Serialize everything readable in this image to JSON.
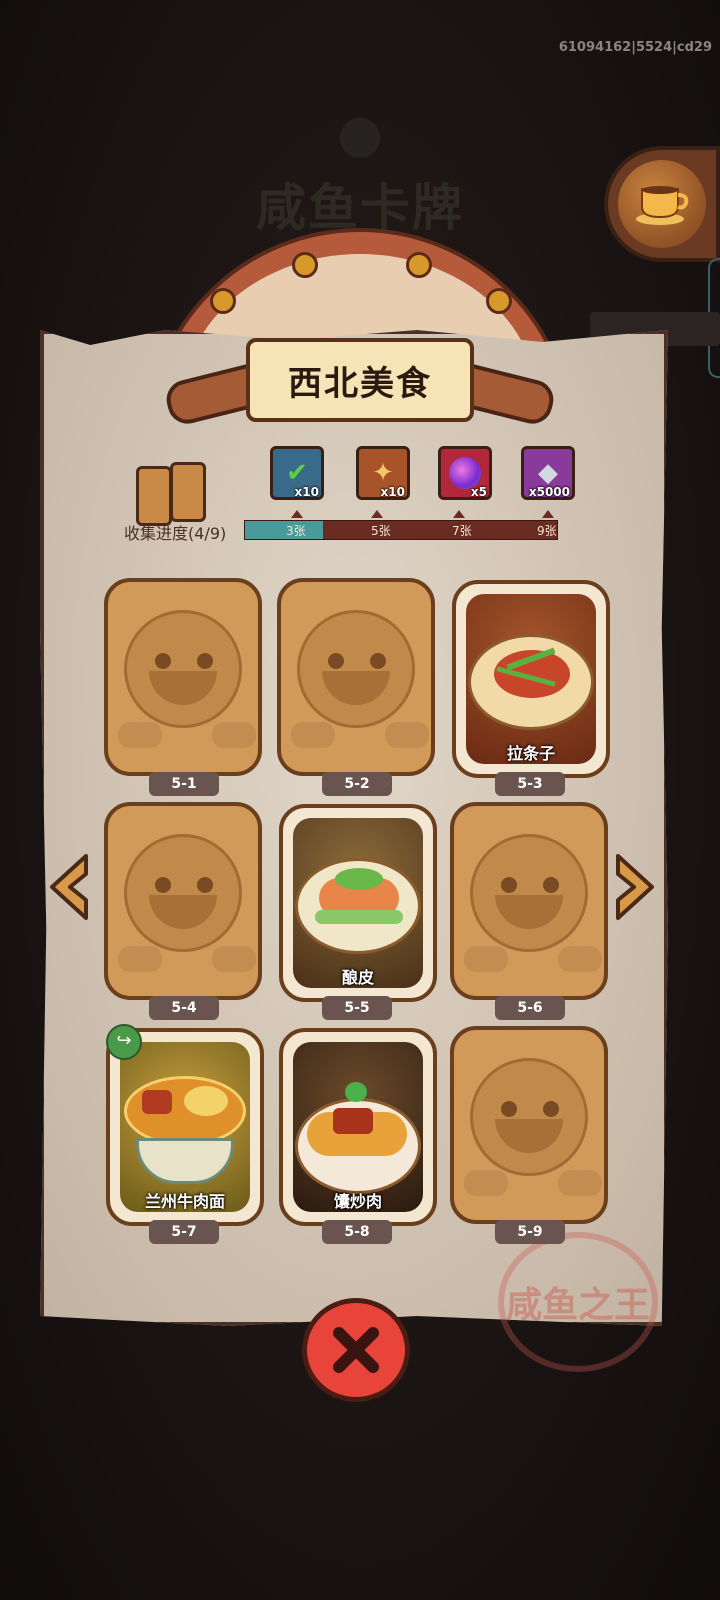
{
  "debug_id": "61094162|5524|cd29",
  "background_title": "咸鱼卡牌",
  "panel": {
    "title": "西北美食",
    "collect_label": "收集进度(4/9)",
    "progress": {
      "collected": 4,
      "total": 9
    }
  },
  "rewards": [
    {
      "icon": "chest-check-icon",
      "qty": "x10"
    },
    {
      "icon": "key-scroll-icon",
      "qty": "x10"
    },
    {
      "icon": "purple-orb-icon",
      "qty": "x5"
    },
    {
      "icon": "crystal-icon",
      "qty": "x5000"
    }
  ],
  "tiers": [
    "3张",
    "5张",
    "7张",
    "9张"
  ],
  "cards": [
    {
      "id": "5-1",
      "name": "",
      "unlocked": false
    },
    {
      "id": "5-2",
      "name": "",
      "unlocked": false
    },
    {
      "id": "5-3",
      "name": "拉条子",
      "unlocked": true
    },
    {
      "id": "5-4",
      "name": "",
      "unlocked": false
    },
    {
      "id": "5-5",
      "name": "酿皮",
      "unlocked": true
    },
    {
      "id": "5-6",
      "name": "",
      "unlocked": false
    },
    {
      "id": "5-7",
      "name": "兰州牛肉面",
      "unlocked": true
    },
    {
      "id": "5-8",
      "name": "馕炒肉",
      "unlocked": true
    },
    {
      "id": "5-9",
      "name": "",
      "unlocked": false
    }
  ],
  "stamp_text": "咸鱼之王",
  "colors": {
    "progress_fill": "#4a9a9a",
    "close_button": "#e8443a"
  }
}
